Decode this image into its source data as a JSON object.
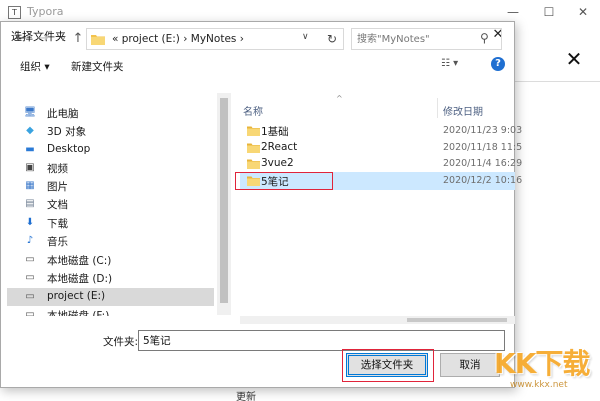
{
  "app": {
    "title": "Typora",
    "icon_glyph": "T",
    "minimize_glyph": "—",
    "maximize_glyph": "☐",
    "close_glyph": "✕",
    "panel_close_glyph": "✕",
    "bottom_text": "更新"
  },
  "dialog": {
    "title": "选择文件夹",
    "close_glyph": "✕",
    "nav": {
      "back_glyph": "←",
      "forward_glyph": "→",
      "recent_glyph": "∨",
      "up_glyph": "↑"
    },
    "address": {
      "text": "«  project (E:)  ›  MyNotes  ›",
      "dropdown_glyph": "∨",
      "refresh_glyph": "↻"
    },
    "search": {
      "placeholder": "搜索\"MyNotes\"",
      "icon_glyph": "⚲"
    },
    "toolbar": {
      "organize": "组织 ▾",
      "new_folder": "新建文件夹",
      "view_glyph": "☷ ▾",
      "help_glyph": "?"
    },
    "nav_pane": {
      "items": [
        {
          "label": "此电脑",
          "icon": "computer-icon",
          "glyph": "🖥",
          "color": "#3b78c9"
        },
        {
          "label": "3D 对象",
          "icon": "3d-objects-icon",
          "glyph": "◆",
          "color": "#3aa3e0"
        },
        {
          "label": "Desktop",
          "icon": "desktop-icon",
          "glyph": "▬",
          "color": "#2a7ad6"
        },
        {
          "label": "视频",
          "icon": "video-icon",
          "glyph": "▣",
          "color": "#444444"
        },
        {
          "label": "图片",
          "icon": "pictures-icon",
          "glyph": "▦",
          "color": "#3b78c9"
        },
        {
          "label": "文档",
          "icon": "documents-icon",
          "glyph": "▤",
          "color": "#6d7c90"
        },
        {
          "label": "下载",
          "icon": "download-icon",
          "glyph": "⬇",
          "color": "#1f6fd1"
        },
        {
          "label": "音乐",
          "icon": "music-icon",
          "glyph": "♪",
          "color": "#1f6fd1"
        },
        {
          "label": "本地磁盘 (C:)",
          "icon": "drive-c-icon",
          "glyph": "▭",
          "color": "#555555"
        },
        {
          "label": "本地磁盘 (D:)",
          "icon": "drive-d-icon",
          "glyph": "▭",
          "color": "#555555"
        },
        {
          "label": "project (E:)",
          "icon": "drive-e-icon",
          "glyph": "▭",
          "color": "#555555",
          "selected": true
        },
        {
          "label": "本地磁盘 (F:)",
          "icon": "drive-f-icon",
          "glyph": "▭",
          "color": "#555555"
        }
      ]
    },
    "file_list": {
      "sort_glyph": "^",
      "columns": {
        "name": "名称",
        "date": "修改日期"
      },
      "rows": [
        {
          "name": "1基础",
          "date": "2020/11/23 9:03"
        },
        {
          "name": "2React",
          "date": "2020/11/18 11:5"
        },
        {
          "name": "3vue2",
          "date": "2020/11/4 16:29"
        },
        {
          "name": "5笔记",
          "date": "2020/12/2 10:16",
          "selected": true
        }
      ]
    },
    "filename": {
      "label": "文件夹:",
      "value": "5笔记"
    },
    "buttons": {
      "select": "选择文件夹",
      "cancel": "取消"
    }
  },
  "watermark": {
    "text": "KK下载",
    "url": "www.kkx.net"
  },
  "colors": {
    "folder": "#f3c34d",
    "highlight_border": "#e0243a",
    "selection": "#cce8ff",
    "accent": "#0078d7"
  }
}
